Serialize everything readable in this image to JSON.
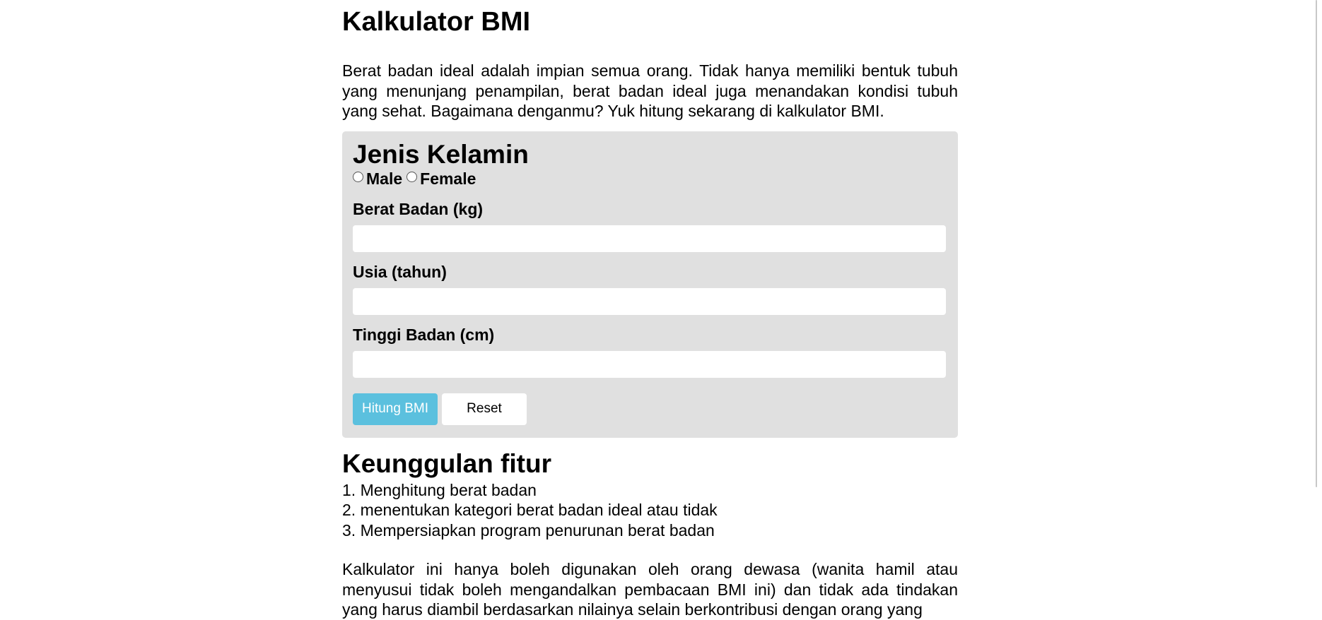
{
  "page": {
    "title": "Kalkulator BMI",
    "intro": "Berat badan ideal adalah impian semua orang. Tidak hanya memiliki bentuk tubuh yang menunjang penampilan, berat badan ideal juga menandakan kondisi tubuh yang sehat. Bagaimana denganmu? Yuk hitung sekarang di kalkulator BMI."
  },
  "form": {
    "gender_title": "Jenis Kelamin",
    "gender_options": [
      "Male",
      "Female"
    ],
    "weight_label": "Berat Badan (kg)",
    "weight_value": "",
    "age_label": "Usia (tahun)",
    "age_value": "",
    "height_label": "Tinggi Badan (cm)",
    "height_value": "",
    "calculate_label": "Hitung BMI",
    "reset_label": "Reset",
    "primary_color": "#5bc0de",
    "card_color": "#e0e0e0"
  },
  "features": {
    "title": "Keunggulan fitur",
    "items": [
      "1. Menghitung berat badan",
      "2. menentukan kategori berat badan ideal atau tidak",
      "3. Mempersiapkan program penurunan berat badan"
    ]
  },
  "disclaimer": "Kalkulator ini hanya boleh digunakan oleh orang dewasa (wanita hamil atau menyusui tidak boleh mengandalkan pembacaan BMI ini) dan tidak ada tindakan yang harus diambil berdasarkan nilainya selain berkontribusi dengan orang yang"
}
